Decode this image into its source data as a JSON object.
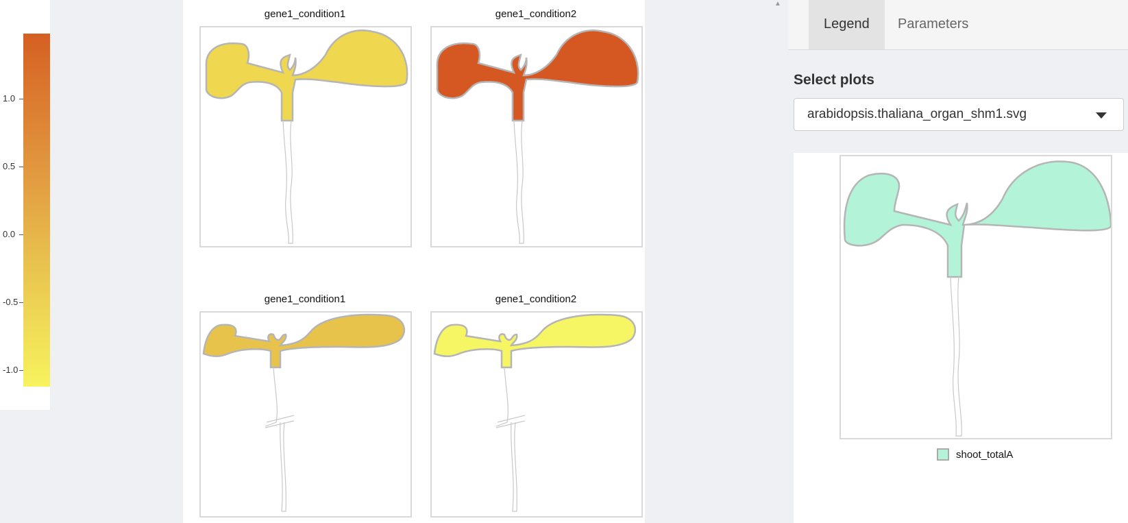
{
  "color_key": {
    "ticks": [
      {
        "label": "1.0",
        "value": 1.0
      },
      {
        "label": "0.5",
        "value": 0.5
      },
      {
        "label": "0.0",
        "value": 0.0
      },
      {
        "label": "-0.5",
        "value": -0.5
      },
      {
        "label": "-1.0",
        "value": -1.0
      }
    ],
    "colors": {
      "high": "#d55f22",
      "mid": "#e8c24e",
      "low": "#f7f35e"
    }
  },
  "plots": [
    {
      "title": "gene1_condition1",
      "fill": "#efd850"
    },
    {
      "title": "gene1_condition2",
      "fill": "#d55822"
    },
    {
      "title": "gene1_condition1",
      "fill": "#e8c34c"
    },
    {
      "title": "gene1_condition2",
      "fill": "#f6f664"
    }
  ],
  "sidebar": {
    "tabs": [
      {
        "label": "Legend",
        "active": true
      },
      {
        "label": "Parameters",
        "active": false
      }
    ],
    "select_label": "Select plots",
    "select_value": "arabidopsis.thaliana_organ_shm1.svg",
    "legend": {
      "key_label": "shoot_totalA",
      "key_color": "#b3f3d8"
    }
  },
  "icons": {
    "dropdown": "chevron-down-icon",
    "scroll": "scroll-up-arrow-icon"
  }
}
